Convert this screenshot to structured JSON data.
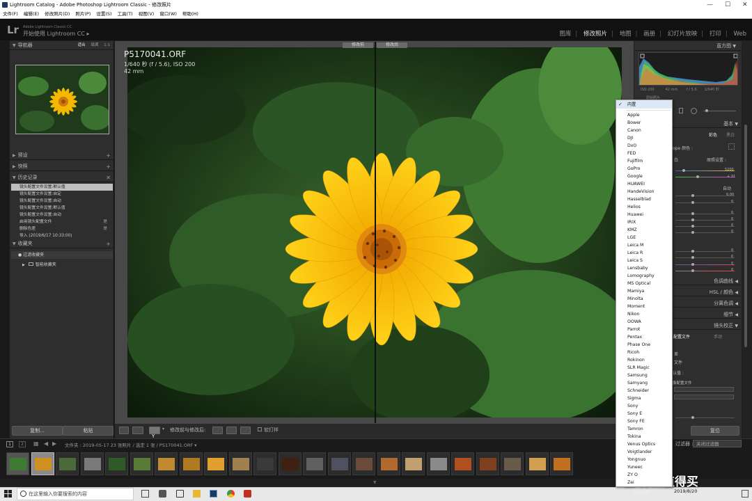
{
  "window": {
    "title": "Lightroom Catalog - Adobe Photoshop Lightroom Classic - 修改照片",
    "minimize": "—",
    "maximize": "☐",
    "close": "✕"
  },
  "menubar": [
    "文件(F)",
    "编辑(E)",
    "修改照片(D)",
    "照片(P)",
    "设置(S)",
    "工具(T)",
    "视图(V)",
    "窗口(W)",
    "帮助(H)"
  ],
  "identity": {
    "logo": "Lr",
    "app_small": "Adobe Lightroom Classic CC",
    "get_started": "开始使用 Lightroom CC",
    "get_started_arrow": "▸"
  },
  "modules": [
    {
      "label": "图库",
      "active": false
    },
    {
      "label": "修改照片",
      "active": true
    },
    {
      "label": "地图",
      "active": false
    },
    {
      "label": "画册",
      "active": false
    },
    {
      "label": "幻灯片放映",
      "active": false
    },
    {
      "label": "打印",
      "active": false
    },
    {
      "label": "Web",
      "active": false
    }
  ],
  "left_panel": {
    "navigator": {
      "title": "导航器",
      "options": [
        "适合",
        "填满",
        "1:1"
      ]
    },
    "presets": {
      "title": "预设"
    },
    "snapshots": {
      "title": "快照"
    },
    "history": {
      "title": "历史记录",
      "close": "✕",
      "items": [
        {
          "label": "镜头配置文件设置:默认值",
          "value": "",
          "selected": true
        },
        {
          "label": "镜头配置文件设置:自定",
          "value": "",
          "selected": false
        },
        {
          "label": "镜头配置文件设置:自动",
          "value": "",
          "selected": false
        },
        {
          "label": "镜头配置文件设置:默认值",
          "value": "",
          "selected": false
        },
        {
          "label": "镜头配置文件设置:自动",
          "value": "",
          "selected": false
        },
        {
          "label": "启用镜头配置文件",
          "value": "是",
          "selected": false
        },
        {
          "label": "删除色差",
          "value": "是",
          "selected": false
        },
        {
          "label": "导入 (2019/6/17 10:33:00)",
          "value": "",
          "selected": false
        }
      ]
    },
    "collections": {
      "title": "收藏夹",
      "items": [
        "过滤收藏夹",
        "智能收藏夹"
      ]
    },
    "copy_button": "复制...",
    "paste_button": "粘贴"
  },
  "photo": {
    "filename": "P5170041.ORF",
    "exposure_info": "1/640 秒 (f / 5.6),   ISO 200",
    "focal": "42 mm",
    "before_label": "修改前",
    "after_label": "修改后"
  },
  "toolbar": {
    "mode_label": "修改前与修改后:",
    "soft_proof": "软打样"
  },
  "right_panel": {
    "histogram_title": "直方图",
    "histogram_info": [
      "ISO 200",
      "42 mm",
      "f / 5.6",
      "1/640 秒"
    ],
    "original_photo": "原始照片",
    "basic_title": "基本",
    "color_label": "彩色",
    "bw_label": "黑白",
    "profile_label": "ope 颜色 :",
    "wb_label": "白",
    "as_shot": "原照设置 :",
    "temp_value": "5200",
    "tint_value": "+ 31",
    "auto_label": "自动",
    "zero_values": [
      "0.00",
      "0",
      "0",
      "0",
      "0",
      "0",
      "0",
      "0",
      "0",
      "0"
    ],
    "tone_curve": "色调曲线",
    "hsl": "HSL / 颜色",
    "split_toning": "分离色调",
    "detail": "细节",
    "lens_corrections": "镜头校正",
    "profile_tab": "配置文件",
    "manual_tab": "手动",
    "remove_ca": "差",
    "enable_profile": "文件",
    "setup_label": "认值 :",
    "lens_profile_label": "像配置文件",
    "reset_button": "复位"
  },
  "filmstrip": {
    "pages": [
      "1",
      "2"
    ],
    "path_text": "文件夹 : 2019-05-17   23 张照片 / 选定 1 张 / P5170041.ORF",
    "filter_label": "过滤器 :",
    "filter_value": "关闭过滤器"
  },
  "taskbar": {
    "search_placeholder": "在这里输入你要搜索的内容",
    "time": "",
    "date": "2019/8/20"
  },
  "watermark": "值 什么值得买",
  "lens_make_dropdown": {
    "selected": "内置",
    "items": [
      "Apple",
      "Bower",
      "Canon",
      "DJI",
      "DxO",
      "FED",
      "Fujifilm",
      "GoPro",
      "Google",
      "HUAWEI",
      "HandeVision",
      "Hasselblad",
      "Helios",
      "Huawei",
      "IRIX",
      "KMZ",
      "LGE",
      "Leica M",
      "Leica R",
      "Leica S",
      "Lensbaby",
      "Lomography",
      "MS Optical",
      "Mamiya",
      "Minolta",
      "Moment",
      "Nikon",
      "OOWA",
      "Parrot",
      "Pentax",
      "Phase One",
      "Ricoh",
      "Rokinon",
      "SLR Magic",
      "Samsung",
      "Samyang",
      "Schneider",
      "Sigma",
      "Sony",
      "Sony E",
      "Sony FE",
      "Tamron",
      "Tokina",
      "Venus Optics",
      "Voigtlander",
      "Yongnuo",
      "Yuneec",
      "ZY O",
      "Zei"
    ]
  },
  "colors": {
    "accent_flower": "#f5b800",
    "panel_bg": "#2e2e2e",
    "leaf_green": "#3f7a32"
  }
}
